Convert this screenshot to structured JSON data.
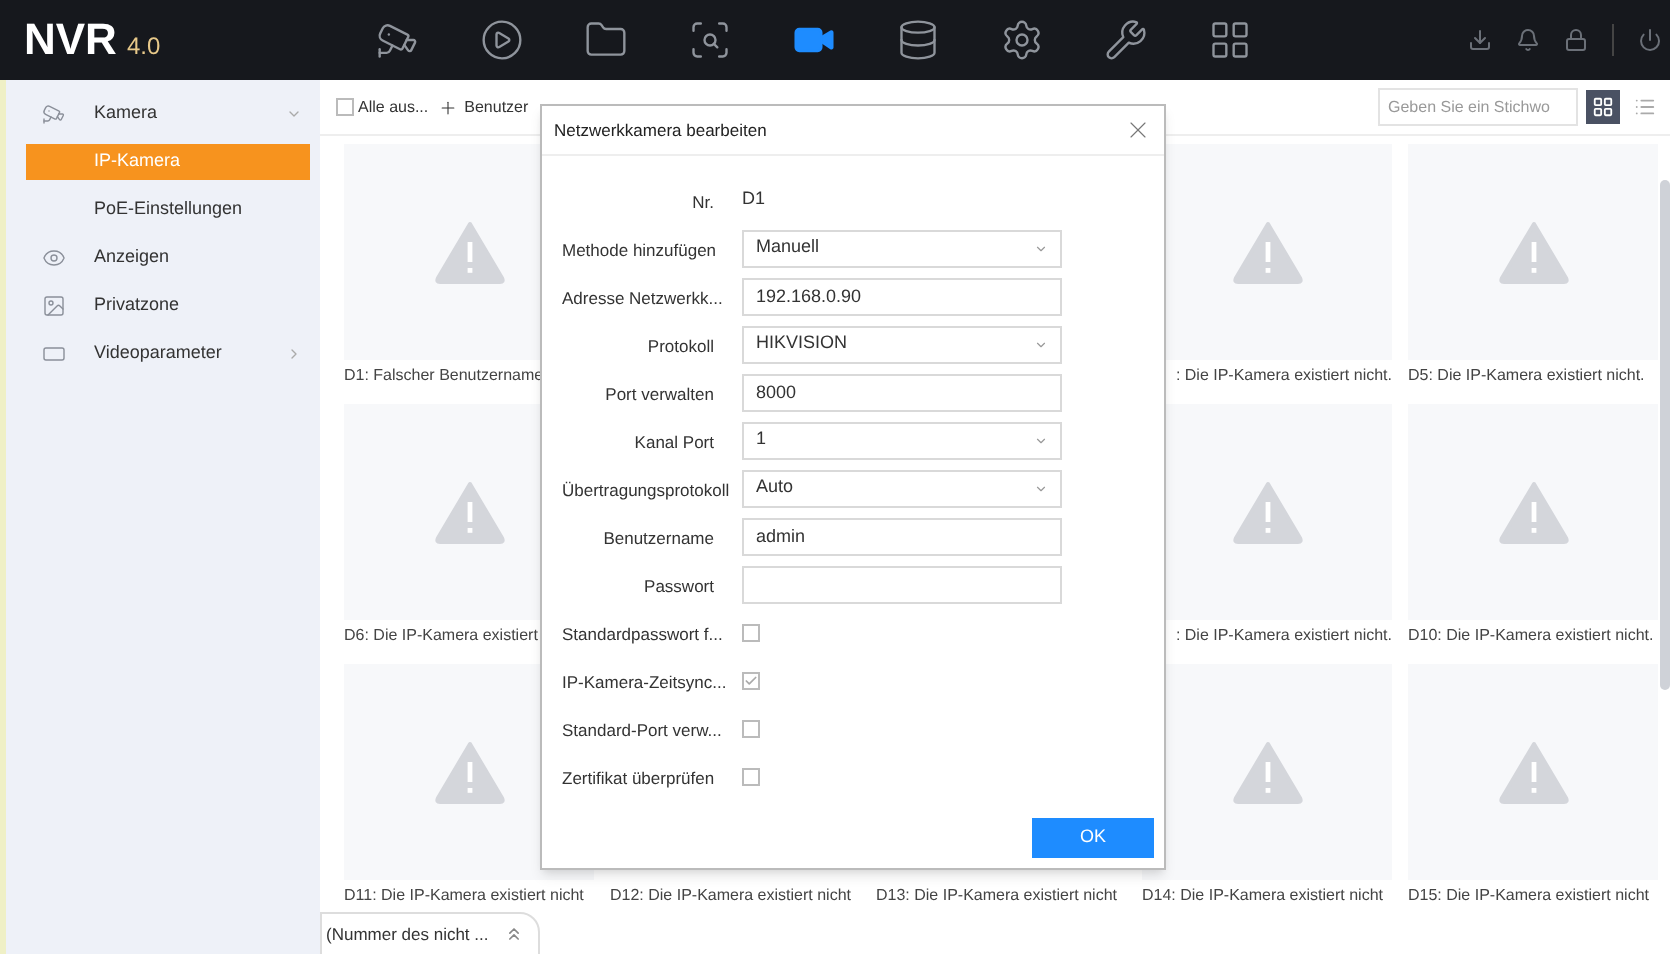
{
  "top_bar": {
    "logo": "NVR",
    "version": "4.0",
    "nav": [
      {
        "selected": false
      },
      {
        "selected": false
      },
      {
        "selected": false
      },
      {
        "selected": false
      },
      {
        "selected": true
      },
      {
        "selected": false
      },
      {
        "selected": false
      },
      {
        "selected": false
      },
      {
        "selected": false
      }
    ]
  },
  "sidebar": {
    "items": [
      {
        "label": "Kamera",
        "expanded": true,
        "selected": false,
        "children": [
          {
            "label": "IP-Kamera",
            "selected": true
          },
          {
            "label": "PoE-Einstellungen",
            "selected": false
          }
        ]
      },
      {
        "label": "Anzeigen",
        "selected": false
      },
      {
        "label": "Privatzone",
        "selected": false
      },
      {
        "label": "Videoparameter",
        "expanded": false,
        "selected": false
      }
    ]
  },
  "toolbar": {
    "select_all": {
      "label": "Alle aus...",
      "checked": false
    },
    "add_button": {
      "label": "Benutzer"
    },
    "search": {
      "placeholder": "Geben Sie ein Stichwo"
    },
    "view_modes": [
      {
        "selected": true
      },
      {
        "selected": false
      }
    ]
  },
  "tiles": [
    {
      "kind": "tile",
      "label": "D1: Falscher Benutzername"
    },
    {
      "kind": "empty"
    },
    {
      "kind": "empty"
    },
    {
      "kind": "cut",
      "label": ": Die IP-Kamera existiert nicht."
    },
    {
      "kind": "tile",
      "label": "D5: Die IP-Kamera existiert nicht."
    },
    {
      "kind": "tile",
      "label": "D6: Die IP-Kamera existiert"
    },
    {
      "kind": "empty"
    },
    {
      "kind": "empty"
    },
    {
      "kind": "cut",
      "label": ": Die IP-Kamera existiert nicht."
    },
    {
      "kind": "tile",
      "label": "D10: Die IP-Kamera existiert nicht."
    },
    {
      "kind": "tile",
      "label": "D11: Die IP-Kamera existiert nicht"
    },
    {
      "kind": "label_only",
      "label": "D12: Die IP-Kamera existiert nicht"
    },
    {
      "kind": "label_only",
      "label": "D13: Die IP-Kamera existiert nicht"
    },
    {
      "kind": "tile",
      "label": "D14: Die IP-Kamera existiert nicht"
    },
    {
      "kind": "tile",
      "label": "D15: Die IP-Kamera existiert nicht"
    }
  ],
  "dialog": {
    "title": "Netzwerkkamera bearbeiten",
    "fields": [
      {
        "kind": "text",
        "label": "Nr.",
        "value": "D1"
      },
      {
        "kind": "select",
        "label": "Methode hinzufügen",
        "value": "Manuell"
      },
      {
        "kind": "input",
        "label": "Adresse Netzwerkk...",
        "value": "192.168.0.90"
      },
      {
        "kind": "select",
        "label": "Protokoll",
        "value": "HIKVISION"
      },
      {
        "kind": "input",
        "label": "Port verwalten",
        "value": "8000"
      },
      {
        "kind": "select",
        "label": "Kanal Port",
        "value": "1"
      },
      {
        "kind": "select",
        "label": "Übertragungsprotokoll",
        "value": "Auto"
      },
      {
        "kind": "input",
        "label": "Benutzername",
        "value": "admin"
      },
      {
        "kind": "input",
        "label": "Passwort"
      },
      {
        "kind": "checkbox",
        "label": "Standardpasswort f...",
        "checked": false
      },
      {
        "kind": "checkbox",
        "label": "IP-Kamera-Zeitsync...",
        "checked": true
      },
      {
        "kind": "checkbox",
        "label": "Standard-Port verw...",
        "checked": false
      },
      {
        "kind": "checkbox",
        "label": "Zertifikat überprüfen",
        "checked": false
      }
    ],
    "ok_button": "OK"
  },
  "bottom_tab": {
    "label": "(Nummer des nicht ..."
  }
}
